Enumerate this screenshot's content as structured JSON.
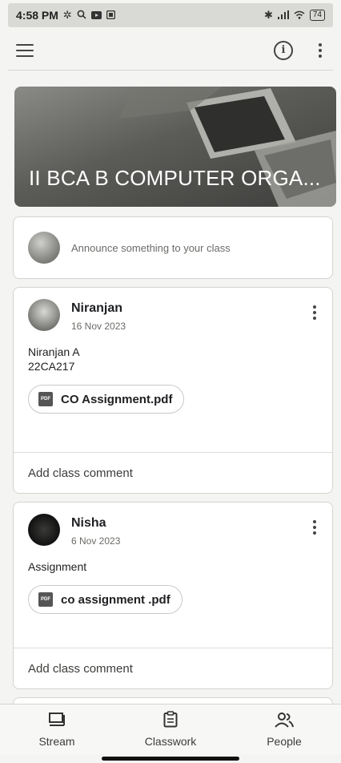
{
  "status_bar": {
    "time": "4:58 PM",
    "left_icons": [
      "gear-icon",
      "search-icon",
      "youtube-icon",
      "notification-icon"
    ],
    "right_icons": [
      "bluetooth-icon",
      "signal-icon",
      "wifi-icon"
    ],
    "battery": "74"
  },
  "top_bar": {
    "menu_icon": "menu-icon",
    "info_icon": "info-icon",
    "more_icon": "more-vert-icon"
  },
  "class_banner": {
    "title": "II BCA B COMPUTER ORGA..."
  },
  "announce": {
    "placeholder": "Announce something to your class"
  },
  "posts": [
    {
      "author": "Niranjan",
      "date": "16 Nov 2023",
      "body_lines": [
        "Niranjan A",
        "22CA217"
      ],
      "attachment": "CO Assignment.pdf",
      "attachment_badge": "PDF",
      "comment_label": "Add class comment"
    },
    {
      "author": "Nisha",
      "date": "6 Nov 2023",
      "body_lines": [
        "Assignment"
      ],
      "attachment": "co assignment .pdf",
      "attachment_badge": "PDF",
      "comment_label": "Add class comment"
    }
  ],
  "bottom_nav": [
    {
      "label": "Stream",
      "icon": "stream-icon"
    },
    {
      "label": "Classwork",
      "icon": "classwork-icon"
    },
    {
      "label": "People",
      "icon": "people-icon"
    }
  ]
}
